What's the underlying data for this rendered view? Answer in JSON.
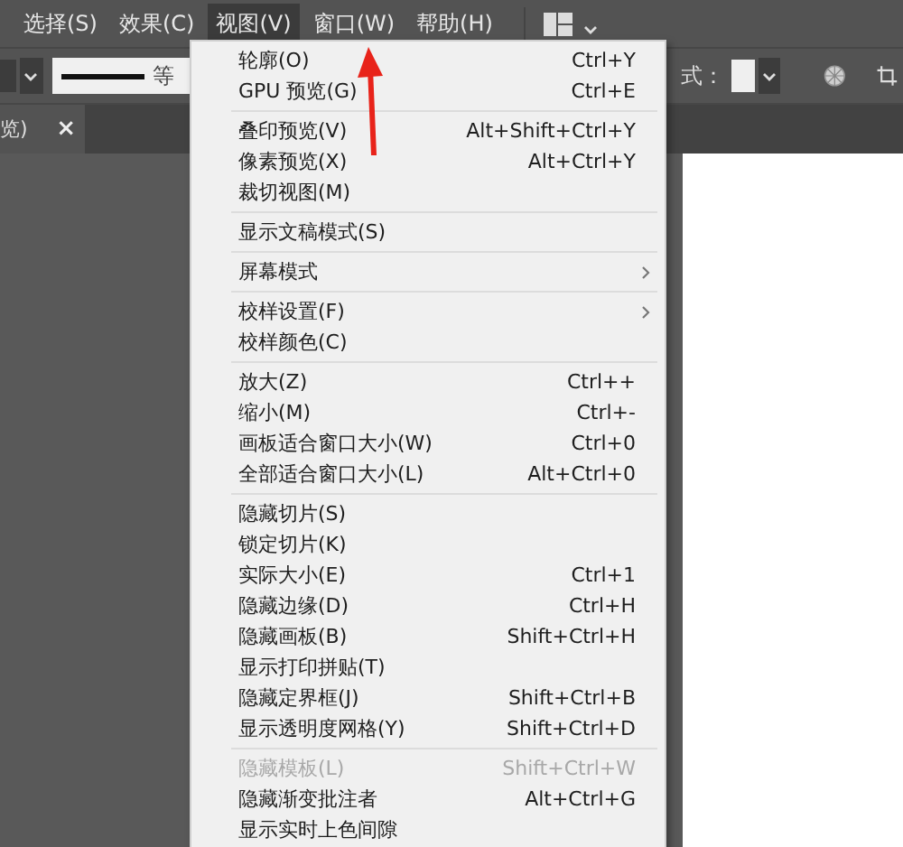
{
  "menu_bar": {
    "items": [
      {
        "label": "选择(S)",
        "selected": false
      },
      {
        "label": "效果(C)",
        "selected": false
      },
      {
        "label": "视图(V)",
        "selected": true
      },
      {
        "label": "窗口(W)",
        "selected": false
      },
      {
        "label": "帮助(H)",
        "selected": false
      }
    ]
  },
  "control_bar": {
    "stroke_label": "等",
    "style_label": "式："
  },
  "document_tab": {
    "title": "览)",
    "close": "×"
  },
  "view_menu": {
    "sections": [
      [
        {
          "label": "轮廓(O)",
          "shortcut": "Ctrl+Y",
          "disabled": false,
          "submenu": false
        },
        {
          "label": "GPU 预览(G)",
          "shortcut": "Ctrl+E",
          "disabled": false,
          "submenu": false
        }
      ],
      [
        {
          "label": "叠印预览(V)",
          "shortcut": "Alt+Shift+Ctrl+Y",
          "disabled": false,
          "submenu": false
        },
        {
          "label": "像素预览(X)",
          "shortcut": "Alt+Ctrl+Y",
          "disabled": false,
          "submenu": false
        },
        {
          "label": "裁切视图(M)",
          "disabled": false,
          "submenu": false
        }
      ],
      [
        {
          "label": "显示文稿模式(S)",
          "disabled": false,
          "submenu": false
        }
      ],
      [
        {
          "label": "屏幕模式",
          "disabled": false,
          "submenu": true
        }
      ],
      [
        {
          "label": "校样设置(F)",
          "disabled": false,
          "submenu": true
        },
        {
          "label": "校样颜色(C)",
          "disabled": false,
          "submenu": false
        }
      ],
      [
        {
          "label": "放大(Z)",
          "shortcut": "Ctrl++",
          "disabled": false,
          "submenu": false
        },
        {
          "label": "缩小(M)",
          "shortcut": "Ctrl+-",
          "disabled": false,
          "submenu": false
        },
        {
          "label": "画板适合窗口大小(W)",
          "shortcut": "Ctrl+0",
          "disabled": false,
          "submenu": false
        },
        {
          "label": "全部适合窗口大小(L)",
          "shortcut": "Alt+Ctrl+0",
          "disabled": false,
          "submenu": false
        }
      ],
      [
        {
          "label": "隐藏切片(S)",
          "disabled": false,
          "submenu": false
        },
        {
          "label": "锁定切片(K)",
          "disabled": false,
          "submenu": false
        },
        {
          "label": "实际大小(E)",
          "shortcut": "Ctrl+1",
          "disabled": false,
          "submenu": false
        },
        {
          "label": "隐藏边缘(D)",
          "shortcut": "Ctrl+H",
          "disabled": false,
          "submenu": false
        },
        {
          "label": "隐藏画板(B)",
          "shortcut": "Shift+Ctrl+H",
          "disabled": false,
          "submenu": false
        },
        {
          "label": "显示打印拼贴(T)",
          "disabled": false,
          "submenu": false
        },
        {
          "label": "隐藏定界框(J)",
          "shortcut": "Shift+Ctrl+B",
          "disabled": false,
          "submenu": false
        },
        {
          "label": "显示透明度网格(Y)",
          "shortcut": "Shift+Ctrl+D",
          "disabled": false,
          "submenu": false
        }
      ],
      [
        {
          "label": "隐藏模板(L)",
          "shortcut": "Shift+Ctrl+W",
          "disabled": true,
          "submenu": false
        },
        {
          "label": "隐藏渐变批注者",
          "shortcut": "Alt+Ctrl+G",
          "disabled": false,
          "submenu": false
        },
        {
          "label": "显示实时上色间隙",
          "disabled": false,
          "submenu": false
        }
      ]
    ]
  }
}
